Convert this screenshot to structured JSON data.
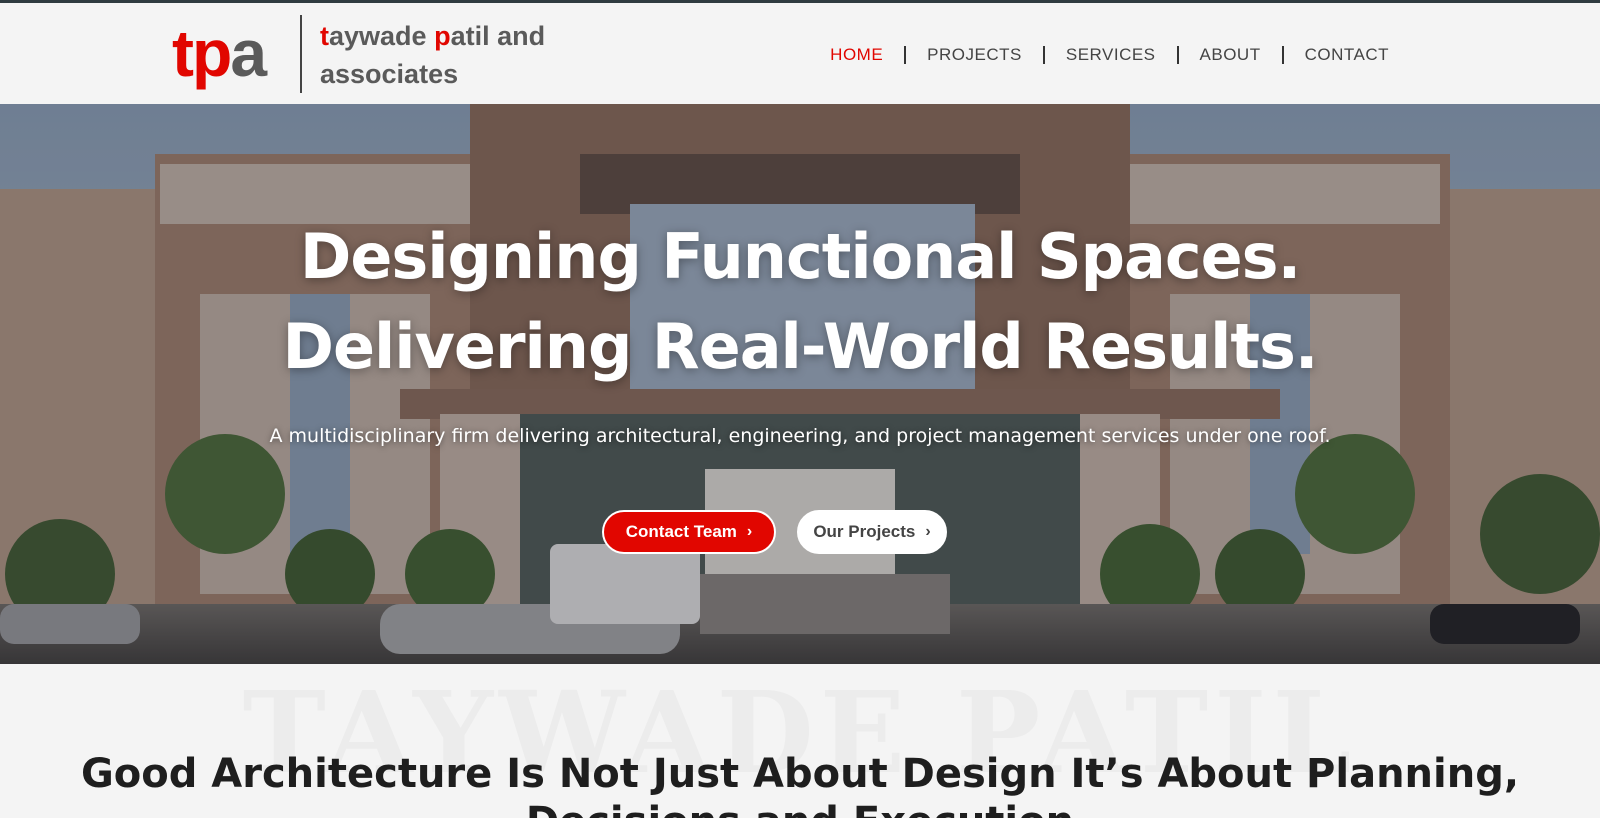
{
  "brand": {
    "mark_t": "t",
    "mark_p": "p",
    "mark_a": "a",
    "name_line1_hl1": "t",
    "name_line1_rest1": "aywade ",
    "name_line1_hl2": "p",
    "name_line1_rest2": "atil and",
    "name_line2": "associates",
    "accent_color": "#e10600"
  },
  "nav": {
    "items": [
      {
        "label": "HOME",
        "active": true
      },
      {
        "label": "PROJECTS",
        "active": false
      },
      {
        "label": "SERVICES",
        "active": false
      },
      {
        "label": "ABOUT",
        "active": false
      },
      {
        "label": "CONTACT",
        "active": false
      }
    ]
  },
  "hero": {
    "title_line1": "Designing Functional Spaces.",
    "title_line2": "Delivering Real-World Results.",
    "subtitle": "A multidisciplinary firm delivering architectural, engineering, and project management services under one roof.",
    "primary_button": "Contact Team",
    "secondary_button": "Our Projects",
    "button_icon": "chevron-right-icon"
  },
  "intro": {
    "watermark": "TAYWADE PATIL",
    "heading_line1": "Good Architecture Is Not Just About Design It’s About Planning,",
    "heading_line2": "Decisions and Execution"
  }
}
